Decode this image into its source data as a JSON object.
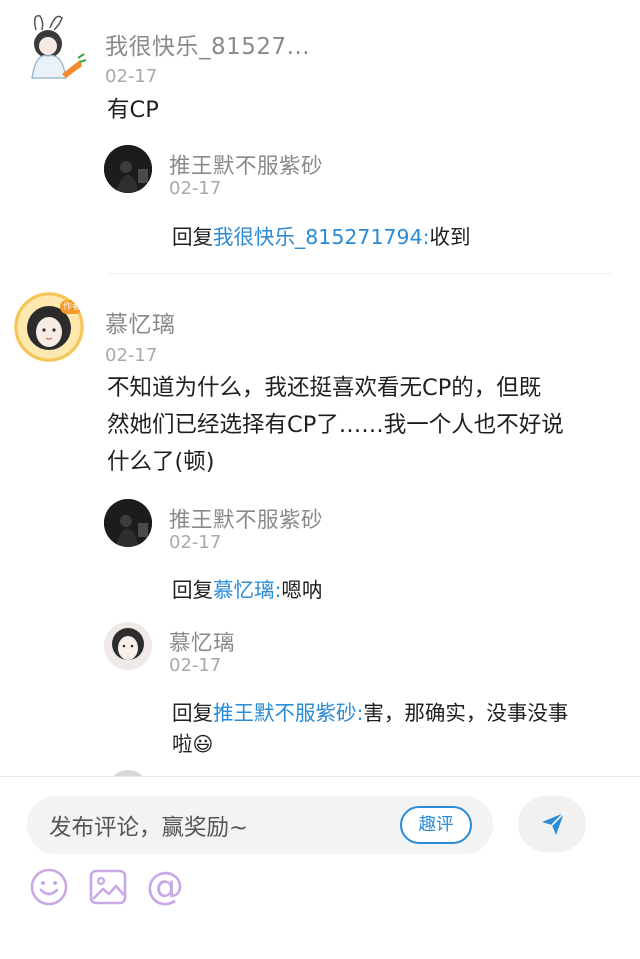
{
  "comments": [
    {
      "username": "我很快乐_81527...",
      "date": "02-17",
      "text": "有CP",
      "replies": [
        {
          "username": "推王默不服紫砂",
          "date": "02-17",
          "reply_prefix": "回复",
          "reply_target": "我很快乐_815271794:",
          "reply_text": "收到"
        }
      ]
    },
    {
      "username": "慕忆璃",
      "date": "02-17",
      "text_lines": [
        "不知道为什么，我还挺喜欢看无CP的，但既",
        "然她们已经选择有CP了……我一个人也不好说",
        "什么了(顿)"
      ],
      "author_badge": "作者",
      "replies": [
        {
          "username": "推王默不服紫砂",
          "date": "02-17",
          "reply_prefix": "回复",
          "reply_target": "慕忆璃:",
          "reply_text": "嗯呐"
        },
        {
          "username": "慕忆璃",
          "date": "02-17",
          "reply_prefix": "回复",
          "reply_target": "推王默不服紫砂:",
          "reply_text_line1": "害，那确实，没事没事",
          "reply_text_line2": "啦",
          "emoji": "😃"
        }
      ]
    }
  ],
  "composer": {
    "placeholder": "发布评论，赢奖励~",
    "quick_comment_label": "趣评",
    "send_icon": "send-icon",
    "tools": [
      "emoji-icon",
      "image-icon",
      "mention-icon"
    ],
    "mention_symbol": "@"
  },
  "colors": {
    "link": "#2a8bd6",
    "tool_icon": "#c9a8e6",
    "username": "#8a8a8a"
  }
}
